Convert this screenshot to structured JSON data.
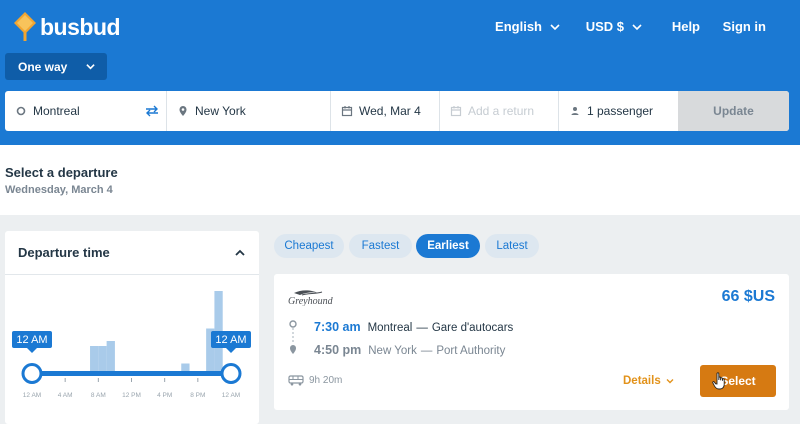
{
  "brand": {
    "name": "busbud",
    "color": "#1b79d3",
    "accent": "#f2a531"
  },
  "nav": {
    "language": "English",
    "currency": "USD $",
    "help": "Help",
    "signin": "Sign in"
  },
  "trip_type": "One way",
  "search": {
    "origin": "Montreal",
    "destination": "New York",
    "date": "Wed, Mar 4",
    "return_placeholder": "Add a return",
    "passengers": "1 passenger",
    "update_label": "Update"
  },
  "date_strip": {
    "title": "Select a departure",
    "subtitle": "Wednesday, March 4"
  },
  "filter": {
    "title": "Departure time",
    "range_start_label": "12 AM",
    "range_end_label": "12 AM",
    "chart_data": {
      "type": "bar",
      "x_ticks": [
        "12 AM",
        "4 AM",
        "8 AM",
        "12 PM",
        "4 PM",
        "8 PM",
        "12 AM"
      ],
      "values": [
        0,
        0,
        0,
        0,
        0,
        0,
        0,
        1,
        1,
        1.2,
        0,
        0,
        0,
        0,
        0,
        0,
        0,
        0,
        0.3,
        0,
        0,
        1.7,
        3.2,
        0
      ],
      "range": [
        0,
        24
      ]
    }
  },
  "sort_tabs": [
    {
      "label": "Cheapest",
      "active": false
    },
    {
      "label": "Fastest",
      "active": false
    },
    {
      "label": "Earliest",
      "active": true
    },
    {
      "label": "Latest",
      "active": false
    }
  ],
  "result": {
    "carrier": "Greyhound",
    "price": "66 $US",
    "departure": {
      "time": "7:30 am",
      "city": "Montreal",
      "station": "Gare d'autocars"
    },
    "arrival": {
      "time": "4:50 pm",
      "city": "New York",
      "station": "Port Authority"
    },
    "duration": "9h 20m",
    "details_label": "Details",
    "select_label": "Select"
  }
}
